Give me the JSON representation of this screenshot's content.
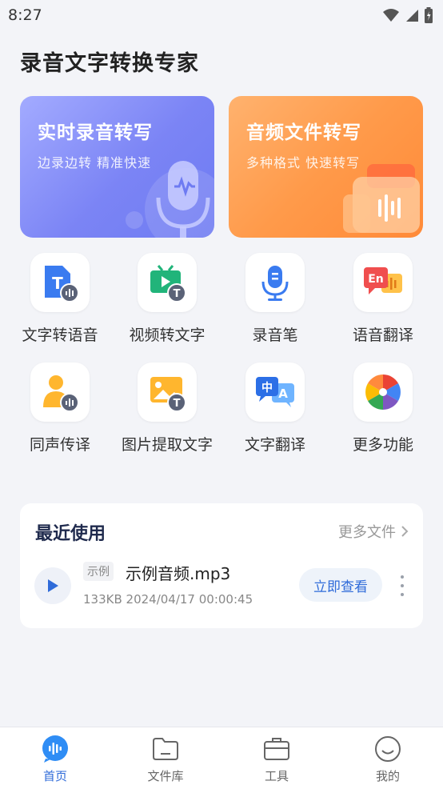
{
  "status_bar": {
    "time": "8:27"
  },
  "app_title": "录音文字转换专家",
  "hero_cards": [
    {
      "title": "实时录音转写",
      "subtitle": "边录边转 精准快速"
    },
    {
      "title": "音频文件转写",
      "subtitle": "多种格式 快速转写"
    }
  ],
  "tools": [
    {
      "label": "文字转语音",
      "icon": "text-to-speech-icon"
    },
    {
      "label": "视频转文字",
      "icon": "video-to-text-icon"
    },
    {
      "label": "录音笔",
      "icon": "microphone-icon"
    },
    {
      "label": "语音翻译",
      "icon": "voice-translate-icon"
    },
    {
      "label": "同声传译",
      "icon": "simultaneous-interpretation-icon"
    },
    {
      "label": "图片提取文字",
      "icon": "image-to-text-icon"
    },
    {
      "label": "文字翻译",
      "icon": "text-translate-icon"
    },
    {
      "label": "更多功能",
      "icon": "more-functions-icon"
    }
  ],
  "recent": {
    "title": "最近使用",
    "more_label": "更多文件",
    "file": {
      "tag": "示例",
      "name": "示例音频.mp3",
      "meta": "133KB 2024/04/17 00:00:45",
      "action_label": "立即查看"
    }
  },
  "tabbar": [
    {
      "label": "首页",
      "icon": "home-wave-icon",
      "active": true
    },
    {
      "label": "文件库",
      "icon": "folder-icon",
      "active": false
    },
    {
      "label": "工具",
      "icon": "toolbox-icon",
      "active": false
    },
    {
      "label": "我的",
      "icon": "smile-icon",
      "active": false
    }
  ],
  "colors": {
    "accent": "#2f6bd9",
    "hero_blue": "#7b84f5",
    "hero_orange": "#ff9a4a",
    "background": "#f3f4f8"
  }
}
